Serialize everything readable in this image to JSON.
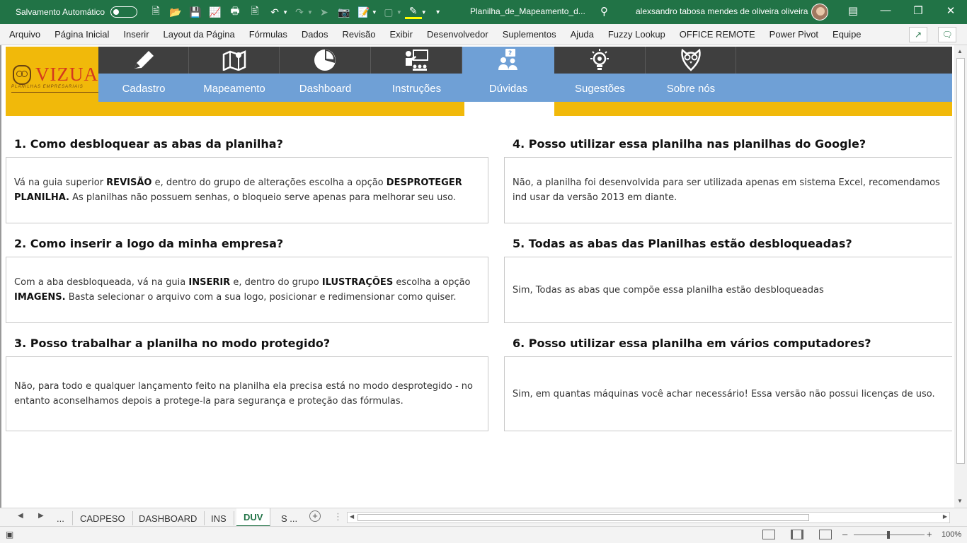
{
  "titlebar": {
    "autosave_label": "Salvamento Automático",
    "doc_title": "Planilha_de_Mapeamento_d...",
    "user_name": "alexsandro tabosa mendes de oliveira oliveira"
  },
  "menu": [
    "Arquivo",
    "Página Inicial",
    "Inserir",
    "Layout da Página",
    "Fórmulas",
    "Dados",
    "Revisão",
    "Exibir",
    "Desenvolvedor",
    "Suplementos",
    "Ajuda",
    "Fuzzy Lookup",
    "OFFICE REMOTE",
    "Power Pivot",
    "Equipe"
  ],
  "logo": {
    "text": "VIZUAL",
    "sub": "PLANILHAS EMPRESARIAIS"
  },
  "nav": [
    {
      "label": "Cadastro",
      "icon": "pencil-icon"
    },
    {
      "label": "Mapeamento",
      "icon": "map-icon"
    },
    {
      "label": "Dashboard",
      "icon": "pie-chart-icon"
    },
    {
      "label": "Instruções",
      "icon": "presentation-icon"
    },
    {
      "label": "Dúvidas",
      "icon": "question-people-icon"
    },
    {
      "label": "Sugestões",
      "icon": "lightbulb-icon"
    },
    {
      "label": "Sobre nós",
      "icon": "owl-pin-icon"
    }
  ],
  "faq": [
    {
      "q": "1. Como desbloquear as abas da planilha?",
      "a_parts": [
        "Vá na guia superior ",
        "REVISÃO",
        " e, dentro do grupo de alterações escolha a opção ",
        "DESPROTEGER PLANILHA.",
        " As planilhas não possuem senhas, o bloqueio serve apenas para melhorar seu uso."
      ]
    },
    {
      "q": "2. Como inserir a logo da minha empresa?",
      "a_parts": [
        "Com a aba desbloqueada, vá na guia ",
        "INSERIR",
        " e, dentro do grupo ",
        "ILUSTRAÇÕES",
        " escolha a opção ",
        "IMAGENS.",
        " Basta selecionar o arquivo com a sua logo, posicionar e redimensionar como quiser."
      ]
    },
    {
      "q": "3. Posso trabalhar a planilha no modo protegido?",
      "a_parts": [
        "Não, para todo e qualquer lançamento feito na planilha ela precisa está no modo desprotegido - no entanto aconselhamos depois a protege-la para segurança e proteção das fórmulas."
      ]
    },
    {
      "q": "4. Posso utilizar essa planilha nas planilhas do Google?",
      "a_parts": [
        "Não, a planilha foi desenvolvida para ser utilizada apenas em sistema Excel, recomendamos ind usar da versão 2013 em diante."
      ]
    },
    {
      "q": "5. Todas as abas das Planilhas estão desbloqueadas?",
      "a_parts": [
        "Sim, Todas as abas que compõe essa planilha estão desbloqueadas"
      ]
    },
    {
      "q": "6. Posso utilizar essa planilha em vários computadores?",
      "a_parts": [
        "Sim, em quantas máquinas você achar necessário! Essa versão não possui licenças de uso."
      ]
    }
  ],
  "tabs": [
    "...",
    "CADPESO",
    "DASHBOARD",
    "INS",
    "DUV",
    "S ..."
  ],
  "active_tab": "DUV",
  "status": {
    "zoom": "100%"
  },
  "colors": {
    "excel_green": "#217346",
    "brand_yellow": "#f1b90a",
    "nav_blue": "#6fa0d6",
    "nav_dark": "#3f3f3f",
    "logo_red": "#d4391e"
  }
}
